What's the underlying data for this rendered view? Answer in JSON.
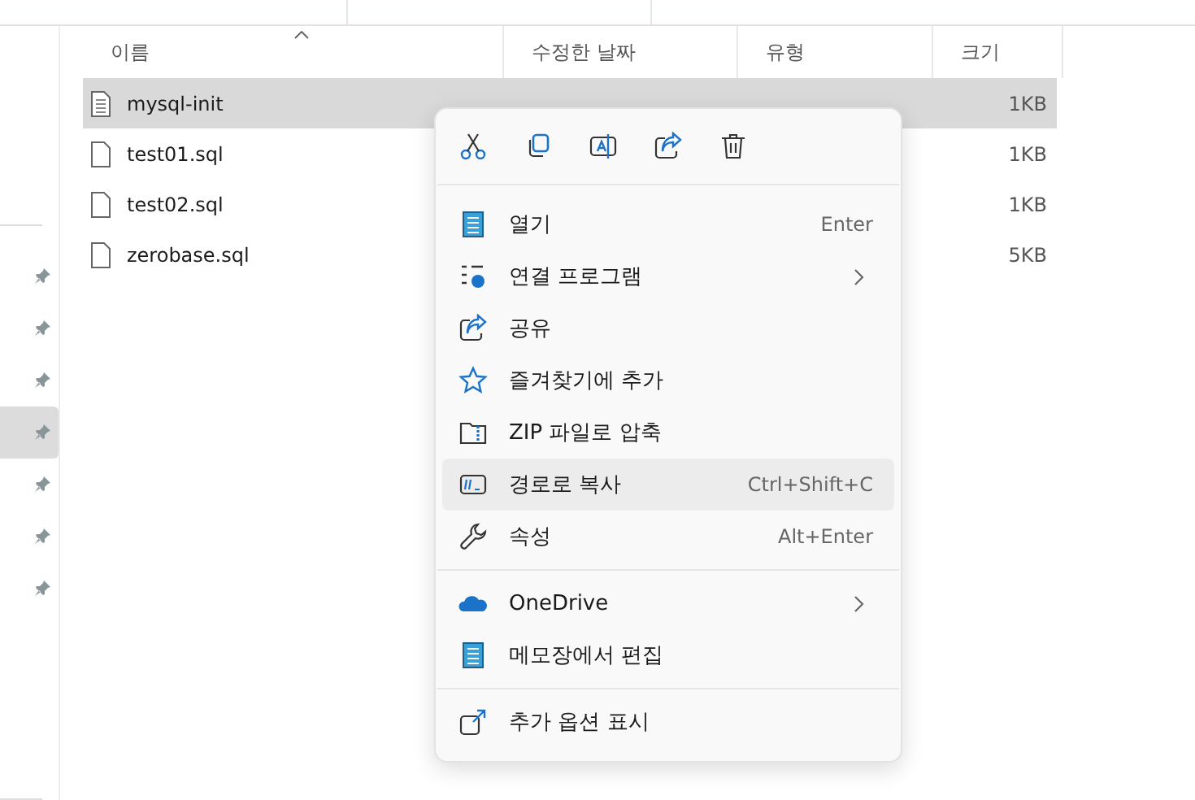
{
  "sidebar": {
    "pins": [
      {
        "selected": false
      },
      {
        "selected": false
      },
      {
        "selected": false
      },
      {
        "selected": true
      },
      {
        "selected": false
      },
      {
        "selected": false
      },
      {
        "selected": false
      }
    ]
  },
  "table": {
    "columns": [
      {
        "label": "이름",
        "sorted": true
      },
      {
        "label": "수정한 날짜",
        "sorted": false
      },
      {
        "label": "유형",
        "sorted": false
      },
      {
        "label": "크기",
        "sorted": false
      }
    ],
    "rows": [
      {
        "name": "mysql-init",
        "size": "1KB",
        "selected": true
      },
      {
        "name": "test01.sql",
        "size": "1KB",
        "selected": false
      },
      {
        "name": "test02.sql",
        "size": "1KB",
        "selected": false
      },
      {
        "name": "zerobase.sql",
        "size": "5KB",
        "selected": false
      }
    ]
  },
  "context_menu": {
    "sections": [
      {
        "items": [
          {
            "label": "열기",
            "shortcut": "Enter",
            "submenu": false,
            "selected": false
          },
          {
            "label": "연결 프로그램",
            "submenu": true,
            "selected": false
          },
          {
            "label": "공유",
            "submenu": false,
            "selected": false
          },
          {
            "label": "즐겨찾기에 추가",
            "submenu": false,
            "selected": false
          },
          {
            "label": "ZIP 파일로 압축",
            "submenu": false,
            "selected": false
          },
          {
            "label": "경로로 복사",
            "shortcut": "Ctrl+Shift+C",
            "submenu": false,
            "selected": true
          },
          {
            "label": "속성",
            "shortcut": "Alt+Enter",
            "submenu": false,
            "selected": false
          }
        ]
      },
      {
        "items": [
          {
            "label": "OneDrive",
            "submenu": true,
            "selected": false
          },
          {
            "label": "메모장에서 편집",
            "submenu": false,
            "selected": false
          }
        ]
      },
      {
        "items": [
          {
            "label": "추가 옵션 표시",
            "submenu": false,
            "selected": false
          }
        ]
      }
    ]
  }
}
